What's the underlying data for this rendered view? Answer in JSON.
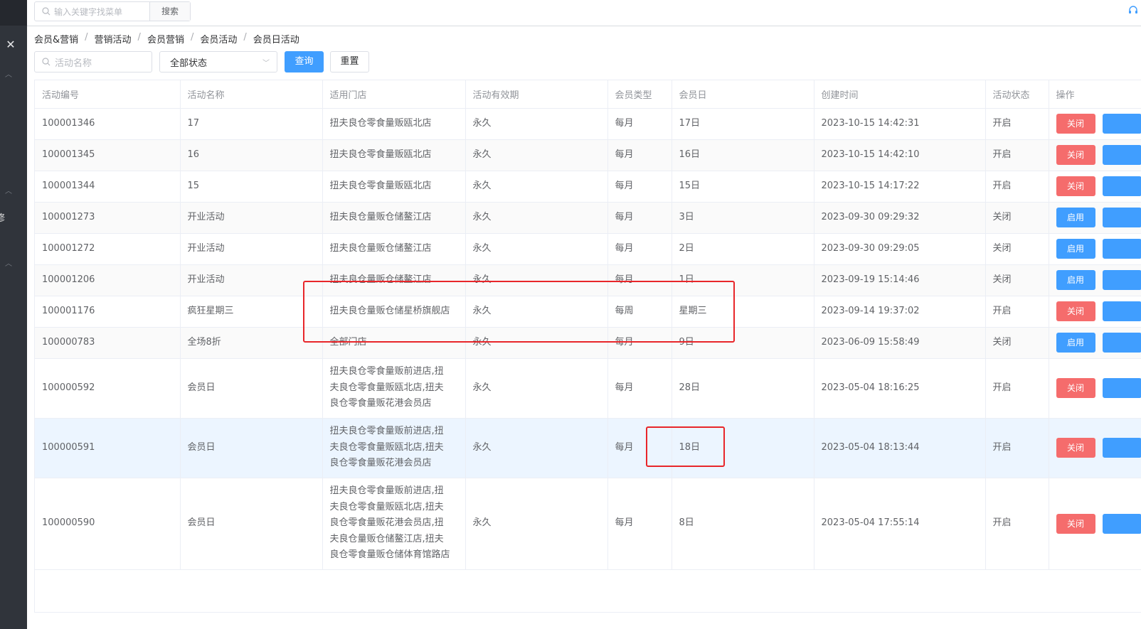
{
  "topbar": {
    "search_placeholder": "输入关键字找菜单",
    "search_button": "搜索"
  },
  "breadcrumb": [
    "会员&营销",
    "营销活动",
    "会员营销",
    "会员活动",
    "会员日活动"
  ],
  "breadcrumb_separator": "/",
  "filters": {
    "name_placeholder": "活动名称",
    "status_value": "全部状态",
    "query_label": "查询",
    "reset_label": "重置"
  },
  "sidebar": {
    "fragment_text": "修"
  },
  "table": {
    "columns": [
      "活动编号",
      "活动名称",
      "适用门店",
      "活动有效期",
      "会员类型",
      "会员日",
      "创建时间",
      "活动状态",
      "操作"
    ],
    "rows": [
      {
        "id": "100001346",
        "name": "17",
        "store": "扭夫良仓零食量贩瓯北店",
        "validity": "永久",
        "type": "每月",
        "day": "17日",
        "created": "2023-10-15 14:42:31",
        "status": "开启",
        "action": "关闭"
      },
      {
        "id": "100001345",
        "name": "16",
        "store": "扭夫良仓零食量贩瓯北店",
        "validity": "永久",
        "type": "每月",
        "day": "16日",
        "created": "2023-10-15 14:42:10",
        "status": "开启",
        "action": "关闭"
      },
      {
        "id": "100001344",
        "name": "15",
        "store": "扭夫良仓零食量贩瓯北店",
        "validity": "永久",
        "type": "每月",
        "day": "15日",
        "created": "2023-10-15 14:17:22",
        "status": "开启",
        "action": "关闭"
      },
      {
        "id": "100001273",
        "name": "开业活动",
        "store": "扭夫良仓量贩仓储鳌江店",
        "validity": "永久",
        "type": "每月",
        "day": "3日",
        "created": "2023-09-30 09:29:32",
        "status": "关闭",
        "action": "启用"
      },
      {
        "id": "100001272",
        "name": "开业活动",
        "store": "扭夫良仓量贩仓储鳌江店",
        "validity": "永久",
        "type": "每月",
        "day": "2日",
        "created": "2023-09-30 09:29:05",
        "status": "关闭",
        "action": "启用"
      },
      {
        "id": "100001206",
        "name": "开业活动",
        "store": "扭夫良仓量贩仓储鳌江店",
        "validity": "永久",
        "type": "每月",
        "day": "1日",
        "created": "2023-09-19 15:14:46",
        "status": "关闭",
        "action": "启用"
      },
      {
        "id": "100001176",
        "name": "疯狂星期三",
        "store": "扭夫良仓量贩仓储星桥旗舰店",
        "validity": "永久",
        "type": "每周",
        "day": "星期三",
        "created": "2023-09-14 19:37:02",
        "status": "开启",
        "action": "关闭"
      },
      {
        "id": "100000783",
        "name": "全场8折",
        "store": "全部门店",
        "validity": "永久",
        "type": "每月",
        "day": "9日",
        "created": "2023-06-09 15:58:49",
        "status": "关闭",
        "action": "启用"
      },
      {
        "id": "100000592",
        "name": "会员日",
        "store_lines": [
          "扭夫良仓零食量贩前进店,扭",
          "夫良仓零食量贩瓯北店,扭夫",
          "良仓零食量贩花港会员店"
        ],
        "validity": "永久",
        "type": "每月",
        "day": "28日",
        "created": "2023-05-04 18:16:25",
        "status": "开启",
        "action": "关闭"
      },
      {
        "id": "100000591",
        "name": "会员日",
        "store_lines": [
          "扭夫良仓零食量贩前进店,扭",
          "夫良仓零食量贩瓯北店,扭夫",
          "良仓零食量贩花港会员店"
        ],
        "validity": "永久",
        "type": "每月",
        "day": "18日",
        "created": "2023-05-04 18:13:44",
        "status": "开启",
        "action": "关闭"
      },
      {
        "id": "100000590",
        "name": "会员日",
        "store_lines": [
          "扭夫良仓零食量贩前进店,扭",
          "夫良仓零食量贩瓯北店,扭夫",
          "良仓零食量贩花港会员店,扭",
          "夫良仓量贩仓储鳌江店,扭夫",
          "良仓零食量贩仓储体育馆路店"
        ],
        "validity": "永久",
        "type": "每月",
        "day": "8日",
        "created": "2023-05-04 17:55:14",
        "status": "开启",
        "action": "关闭"
      }
    ]
  },
  "colors": {
    "primary": "#409eff",
    "danger": "#f56c6c",
    "annotation": "#e8262a",
    "sidebar": "#30343b"
  }
}
